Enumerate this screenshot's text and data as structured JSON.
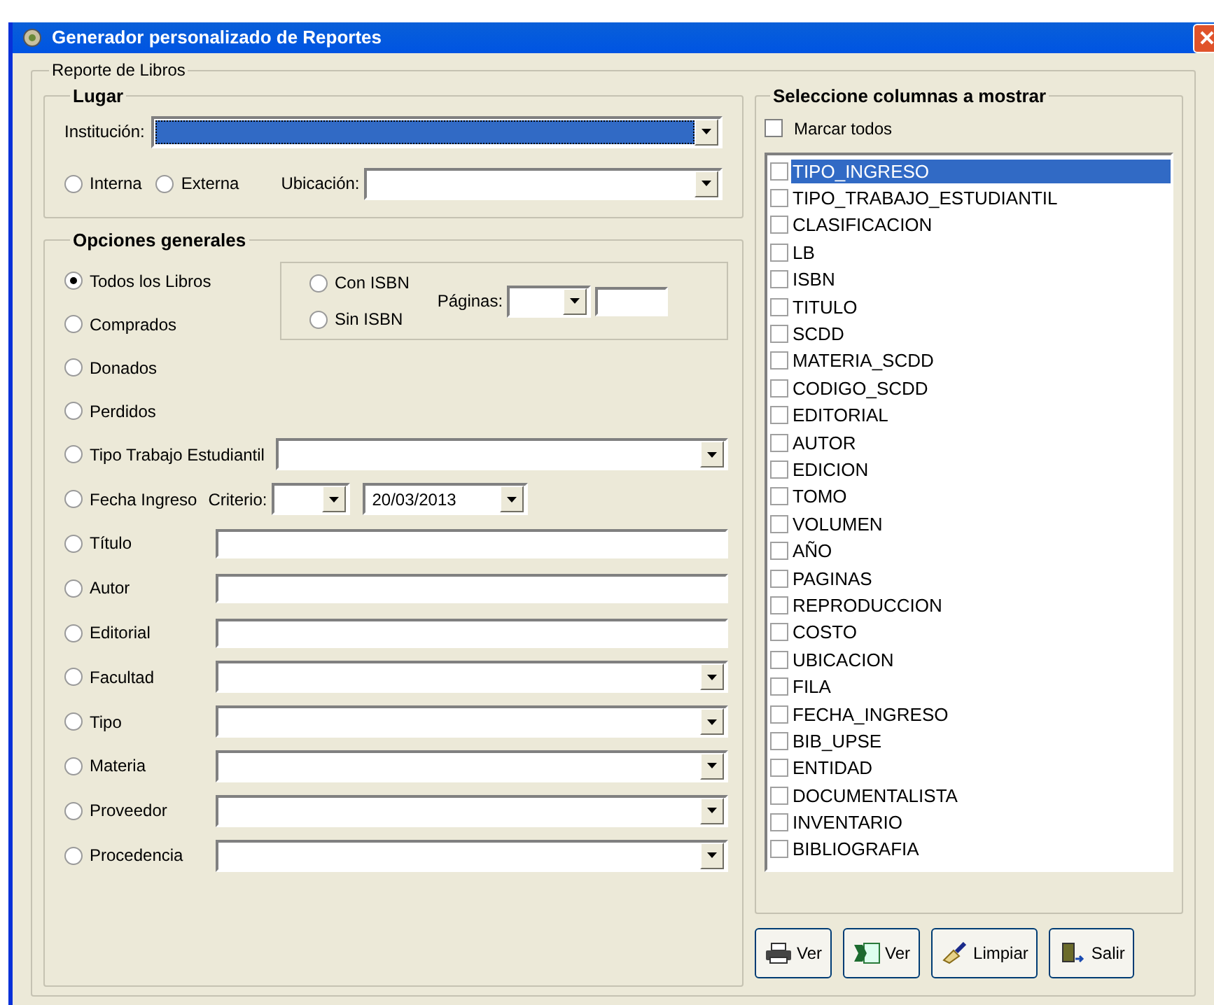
{
  "window": {
    "title": "Generador personalizado de Reportes"
  },
  "report_group": {
    "title": "Reporte de Libros"
  },
  "lugar": {
    "title": "Lugar",
    "institucion": {
      "label": "Institución:",
      "selected": true
    },
    "location_type": [
      {
        "label": "Interna",
        "selected": false
      },
      {
        "label": "Externa",
        "selected": false
      }
    ],
    "ubicacion": {
      "label": "Ubicación:"
    }
  },
  "opciones": {
    "title": "Opciones generales",
    "isbn": [
      {
        "label": "Con ISBN",
        "selected": false
      },
      {
        "label": "Sin ISBN",
        "selected": false
      }
    ],
    "paginas": {
      "label": "Páginas:"
    },
    "filters": [
      {
        "kind": "plain",
        "label": "Todos los Libros",
        "selected": true
      },
      {
        "kind": "plain",
        "label": "Comprados",
        "selected": false
      },
      {
        "kind": "plain",
        "label": "Donados",
        "selected": false
      },
      {
        "kind": "plain",
        "label": "Perdidos",
        "selected": false
      },
      {
        "kind": "wide_combo",
        "label": "Tipo Trabajo Estudiantil",
        "selected": false
      },
      {
        "kind": "date",
        "label": "Fecha Ingreso",
        "selected": false,
        "criterio_label": "Criterio:",
        "date": "20/03/2013"
      },
      {
        "kind": "text",
        "label": "Título",
        "selected": false
      },
      {
        "kind": "text",
        "label": "Autor",
        "selected": false
      },
      {
        "kind": "text",
        "label": "Editorial",
        "selected": false
      },
      {
        "kind": "combo",
        "label": "Facultad",
        "selected": false
      },
      {
        "kind": "combo",
        "label": "Tipo",
        "selected": false
      },
      {
        "kind": "combo",
        "label": "Materia",
        "selected": false
      },
      {
        "kind": "combo",
        "label": "Proveedor",
        "selected": false
      },
      {
        "kind": "combo",
        "label": "Procedencia",
        "selected": false
      }
    ]
  },
  "columns": {
    "title": "Seleccione columnas a mostrar",
    "mark_all": {
      "label": "Marcar todos",
      "checked": false
    },
    "items": [
      {
        "label": "TIPO_INGRESO",
        "checked": false,
        "selected": true
      },
      {
        "label": "TIPO_TRABAJO_ESTUDIANTIL",
        "checked": false,
        "selected": false
      },
      {
        "label": "CLASIFICACION",
        "checked": false,
        "selected": false
      },
      {
        "label": "LB",
        "checked": false,
        "selected": false
      },
      {
        "label": "ISBN",
        "checked": false,
        "selected": false
      },
      {
        "label": "TITULO",
        "checked": false,
        "selected": false
      },
      {
        "label": "SCDD",
        "checked": false,
        "selected": false
      },
      {
        "label": "MATERIA_SCDD",
        "checked": false,
        "selected": false
      },
      {
        "label": "CODIGO_SCDD",
        "checked": false,
        "selected": false
      },
      {
        "label": "EDITORIAL",
        "checked": false,
        "selected": false
      },
      {
        "label": "AUTOR",
        "checked": false,
        "selected": false
      },
      {
        "label": "EDICION",
        "checked": false,
        "selected": false
      },
      {
        "label": "TOMO",
        "checked": false,
        "selected": false
      },
      {
        "label": "VOLUMEN",
        "checked": false,
        "selected": false
      },
      {
        "label": "AÑO",
        "checked": false,
        "selected": false
      },
      {
        "label": "PAGINAS",
        "checked": false,
        "selected": false
      },
      {
        "label": "REPRODUCCION",
        "checked": false,
        "selected": false
      },
      {
        "label": "COSTO",
        "checked": false,
        "selected": false
      },
      {
        "label": "UBICACION",
        "checked": false,
        "selected": false
      },
      {
        "label": "FILA",
        "checked": false,
        "selected": false
      },
      {
        "label": "FECHA_INGRESO",
        "checked": false,
        "selected": false
      },
      {
        "label": "BIB_UPSE",
        "checked": false,
        "selected": false
      },
      {
        "label": "ENTIDAD",
        "checked": false,
        "selected": false
      },
      {
        "label": "DOCUMENTALISTA",
        "checked": false,
        "selected": false
      },
      {
        "label": "INVENTARIO",
        "checked": false,
        "selected": false
      },
      {
        "label": "BIBLIOGRAFIA",
        "checked": false,
        "selected": false
      }
    ]
  },
  "buttons": [
    {
      "kind": "print",
      "label": "Ver"
    },
    {
      "kind": "excel",
      "label": "Ver"
    },
    {
      "kind": "clean",
      "label": "Limpiar"
    },
    {
      "kind": "exit",
      "label": "Salir"
    }
  ]
}
